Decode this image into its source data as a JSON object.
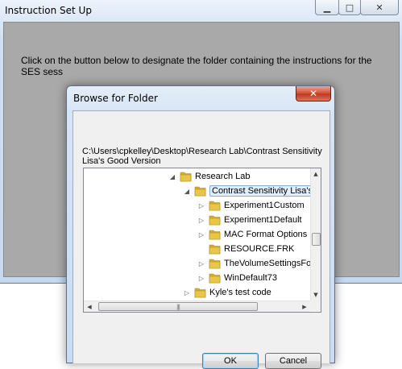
{
  "main_window": {
    "title": "Instruction Set Up",
    "controls": {
      "minimize": "▁",
      "maximize": "□",
      "close": "✕"
    },
    "instruction_line1": "Click on the button below to designate the folder containing the instructions for the",
    "instruction_line2": "SES sess"
  },
  "dialog": {
    "title": "Browse for Folder",
    "close_glyph": "✕",
    "path": "C:\\Users\\cpkelley\\Desktop\\Research Lab\\Contrast Sensitivity Lisa's Good Version",
    "tree": [
      {
        "label": "Research Lab",
        "expander": "◢",
        "depth": 0,
        "selected": false
      },
      {
        "label": "Contrast Sensitivity Lisa's",
        "expander": "◢",
        "depth": 1,
        "selected": true
      },
      {
        "label": "Experiment1Custom",
        "expander": "▷",
        "depth": 2,
        "selected": false
      },
      {
        "label": "Experiment1Default",
        "expander": "▷",
        "depth": 2,
        "selected": false
      },
      {
        "label": "MAC Format Options",
        "expander": "▷",
        "depth": 2,
        "selected": false
      },
      {
        "label": "RESOURCE.FRK",
        "expander": "",
        "depth": 2,
        "selected": false
      },
      {
        "label": "TheVolumeSettingsFo",
        "expander": "▷",
        "depth": 2,
        "selected": false
      },
      {
        "label": "WinDefault73",
        "expander": "▷",
        "depth": 2,
        "selected": false
      },
      {
        "label": "Kyle's test code",
        "expander": "▷",
        "depth": 1,
        "selected": false
      }
    ],
    "buttons": {
      "ok": "OK",
      "cancel": "Cancel"
    }
  },
  "colors": {
    "folder": "#e8c64a",
    "selection_fill": "#e3eefc",
    "selection_border": "#84acdd",
    "close_button": "#c7412a"
  }
}
